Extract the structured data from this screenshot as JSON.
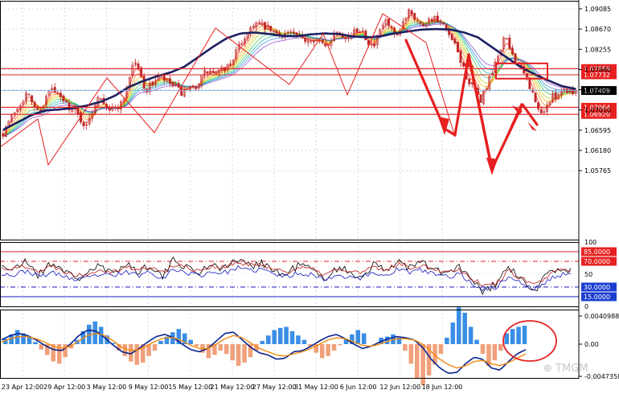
{
  "colors": {
    "background": "#ffffff",
    "grid": "#c8d0dc",
    "axis": "#000000",
    "candle": "#c02828",
    "ribbon": [
      "#ff2a00",
      "#ff7a00",
      "#f2b800",
      "#a8d400",
      "#34c040",
      "#00b49c",
      "#2a88e0",
      "#8a3cc8"
    ],
    "ma_slow": "#1c2060",
    "level_line": "#e02020",
    "current_line": "#7fb0e8",
    "annotation": "#e62020",
    "stoch_main": "#000000",
    "stoch_signal": "#c01818",
    "stoch_third": "#1818c0",
    "stoch_upper": "#e02020",
    "stoch_lower": "#1818c0",
    "macd_pos": "#3a8ee6",
    "macd_neg": "#f0a07a",
    "macd_main": "#0c2490",
    "macd_signal": "#f28a10",
    "tag_red_bg": "#e82020",
    "tag_blue_bg": "#1c3fd0",
    "tag_black_bg": "#000000"
  },
  "chart_data": [
    {
      "type": "candlestick",
      "title": "",
      "series_name": "",
      "x": [
        "23 Apr 12:00",
        "29 Apr 12:00",
        "3 May 12:00",
        "9 May 12:00",
        "15 May 12:00",
        "21 May 12:00",
        "27 May 12:00",
        "31 May 12:00",
        "6 Jun 12:00",
        "12 Jun 12:00",
        "18 Jun 12:00"
      ],
      "ylim": [
        1.0435,
        1.092
      ],
      "yticks": [
        1.09085,
        1.0867,
        1.08255,
        1.0784,
        1.07425,
        1.0701,
        1.06595,
        1.0618,
        1.05765
      ],
      "price_path": [
        1.0655,
        1.07,
        1.0735,
        1.0695,
        1.0745,
        1.072,
        1.07,
        1.0665,
        1.0735,
        1.07,
        1.0715,
        1.0805,
        1.074,
        1.077,
        1.0755,
        1.0735,
        1.0745,
        1.078,
        1.0775,
        1.0795,
        1.084,
        1.088,
        1.087,
        1.0855,
        1.086,
        1.0845,
        1.085,
        1.083,
        1.0865,
        1.085,
        1.087,
        1.0825,
        1.0885,
        1.0845,
        1.091,
        1.0875,
        1.089,
        1.087,
        1.0825,
        1.076,
        1.072,
        1.0775,
        1.085,
        1.08,
        1.076,
        1.069,
        1.0725,
        1.0745,
        1.074
      ],
      "ma_slow_path": [
        1.066,
        1.0675,
        1.069,
        1.07,
        1.0702,
        1.0705,
        1.071,
        1.0718,
        1.073,
        1.0748,
        1.076,
        1.077,
        1.0778,
        1.079,
        1.081,
        1.083,
        1.0848,
        1.0858,
        1.086,
        1.0857,
        1.0853,
        1.0852,
        1.0856,
        1.0858,
        1.0857,
        1.0852,
        1.085,
        1.0852,
        1.0858,
        1.0862,
        1.0866,
        1.0867,
        1.0866,
        1.086,
        1.085,
        1.083,
        1.081,
        1.079,
        1.0775,
        1.0762,
        1.075,
        1.0744
      ],
      "levels": [
        {
          "label": "1.07859",
          "value": 1.07859,
          "style": "red"
        },
        {
          "label": "1.07732",
          "value": 1.07732,
          "style": "red"
        },
        {
          "label": "1.07409",
          "value": 1.07409,
          "style": "black"
        },
        {
          "label": "1.07064",
          "value": 1.07064,
          "style": "red"
        },
        {
          "label": "1.06920",
          "value": 1.0692,
          "style": "red"
        }
      ],
      "annotations": [
        "zigzag trend lines",
        "arrows",
        "box near 1.0780"
      ]
    },
    {
      "type": "line",
      "indicator": "stochastic",
      "ylim": [
        0,
        100
      ],
      "ticks": [
        {
          "label": "100",
          "value": 100,
          "style": "plain"
        },
        {
          "label": "85.0000",
          "value": 85,
          "style": "red"
        },
        {
          "label": "70.0000",
          "value": 70,
          "style": "red"
        },
        {
          "label": "50",
          "value": 50,
          "style": "plain"
        },
        {
          "label": "30.0000",
          "value": 30,
          "style": "blue"
        },
        {
          "label": "15.0000",
          "value": 15,
          "style": "blue"
        },
        {
          "label": "0",
          "value": 0,
          "style": "plain"
        }
      ],
      "series": [
        {
          "values": [
            65,
            55,
            72,
            48,
            68,
            58,
            40,
            55,
            62,
            48,
            70,
            52,
            66,
            45,
            74,
            60,
            52,
            68,
            58,
            74,
            62,
            70,
            55,
            48,
            66,
            58,
            42,
            60,
            54,
            46,
            64,
            55,
            72,
            60,
            68,
            56,
            50,
            62,
            38,
            22,
            35,
            62,
            40,
            22,
            48,
            60,
            55
          ]
        },
        {
          "values": [
            60,
            58,
            64,
            55,
            62,
            56,
            48,
            52,
            58,
            54,
            62,
            56,
            62,
            52,
            66,
            60,
            56,
            62,
            60,
            68,
            63,
            66,
            58,
            54,
            60,
            58,
            50,
            56,
            55,
            52,
            60,
            56,
            66,
            61,
            64,
            58,
            54,
            58,
            44,
            32,
            36,
            55,
            44,
            32,
            44,
            56,
            56
          ]
        },
        {
          "values": [
            52,
            48,
            56,
            46,
            52,
            48,
            40,
            44,
            50,
            46,
            54,
            48,
            54,
            44,
            58,
            52,
            48,
            54,
            52,
            60,
            55,
            58,
            50,
            46,
            52,
            50,
            42,
            48,
            47,
            44,
            52,
            48,
            58,
            53,
            56,
            50,
            46,
            50,
            36,
            26,
            30,
            47,
            36,
            26,
            38,
            49,
            50
          ]
        }
      ]
    },
    {
      "type": "bar",
      "indicator": "macd",
      "ylim": [
        -0.0047358,
        0.0040988
      ],
      "ticks": [
        {
          "label": "0.0040988",
          "value": 0.0040988
        },
        {
          "label": "0.00",
          "value": 0
        },
        {
          "label": "-0.0047358",
          "value": -0.0047358
        }
      ],
      "histogram": [
        0.5,
        0.9,
        1.3,
        1.0,
        0.7,
        0.2,
        -0.5,
        -1.0,
        -1.6,
        -1.8,
        -1.2,
        -0.4,
        0.4,
        1.2,
        1.8,
        2.1,
        1.6,
        0.8,
        0.1,
        -0.6,
        -1.1,
        -1.6,
        -1.9,
        -1.7,
        -1.1,
        -0.6,
        0.3,
        0.7,
        1.1,
        1.4,
        1.0,
        0.4,
        -0.2,
        -0.8,
        -1.3,
        -1.0,
        -0.6,
        -0.9,
        -1.5,
        -2.0,
        -1.7,
        -1.2,
        -0.6,
        0.3,
        0.8,
        1.3,
        1.5,
        1.6,
        1.2,
        0.8,
        0.4,
        -0.2,
        -0.8,
        -1.3,
        -1.1,
        -0.6,
        -0.1,
        0.5,
        0.9,
        1.3,
        1.0,
        0.6,
        0.7,
        0.9,
        0.6,
        -0.6,
        -1.8,
        -3.2,
        -3.8,
        -2.9,
        -1.9,
        -0.9,
        0.6,
        2.0,
        3.4,
        2.9,
        1.6,
        0.4,
        -0.9,
        -2.0,
        -1.5,
        -0.6,
        1.0,
        1.4,
        1.6,
        1.7
      ],
      "main_line": [
        0.4,
        0.8,
        1.0,
        0.8,
        0.4,
        -0.1,
        -0.5,
        -0.6,
        0.0,
        0.8,
        1.3,
        1.2,
        0.6,
        -0.1,
        -0.7,
        -0.9,
        -0.4,
        0.2,
        0.7,
        0.9,
        0.6,
        0.0,
        -0.5,
        -0.7,
        -0.4,
        0.3,
        1.0,
        1.1,
        0.4,
        -0.3,
        -0.8,
        -1.0,
        -1.4,
        -1.3,
        -0.7,
        -0.6,
        -0.2,
        0.3,
        0.7,
        0.9,
        0.5,
        0.0,
        -0.4,
        -0.2,
        0.2,
        0.5,
        0.7,
        0.6,
        0.4,
        -0.3,
        -1.4,
        -2.2,
        -2.7,
        -2.6,
        -1.8,
        -1.2,
        -1.4,
        -2.2,
        -2.4,
        -1.6,
        -0.9,
        -0.5
      ],
      "signal_line": [
        0.2,
        0.5,
        0.7,
        0.7,
        0.5,
        0.2,
        -0.2,
        -0.4,
        -0.2,
        0.3,
        0.8,
        1.0,
        0.8,
        0.3,
        -0.3,
        -0.6,
        -0.5,
        -0.1,
        0.3,
        0.6,
        0.6,
        0.3,
        -0.1,
        -0.4,
        -0.4,
        0.0,
        0.5,
        0.8,
        0.6,
        0.1,
        -0.4,
        -0.7,
        -1.0,
        -1.1,
        -0.9,
        -0.7,
        -0.4,
        0.0,
        0.4,
        0.6,
        0.5,
        0.2,
        -0.1,
        -0.2,
        0.0,
        0.3,
        0.5,
        0.5,
        0.4,
        0.0,
        -0.7,
        -1.4,
        -1.9,
        -2.2,
        -2.0,
        -1.6,
        -1.5,
        -1.8,
        -2.0,
        -1.7,
        -1.3,
        -0.9
      ]
    }
  ],
  "watermark": "⊕ TMGM"
}
